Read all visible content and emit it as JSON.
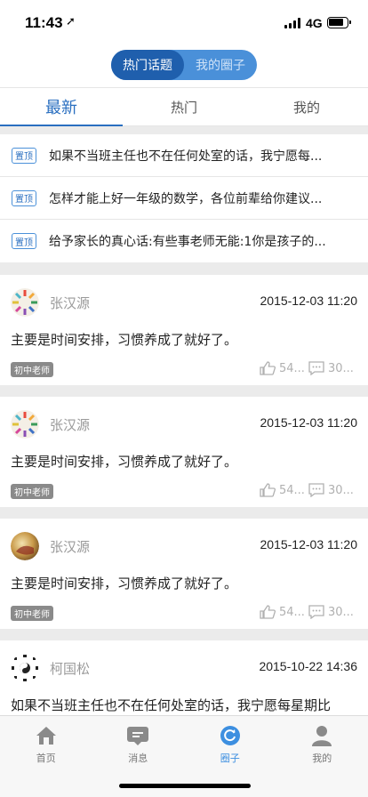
{
  "status": {
    "time": "11:43",
    "network": "4G"
  },
  "segment": {
    "items": [
      "热门话题",
      "我的圈子"
    ]
  },
  "tabs": [
    "最新",
    "热门",
    "我的"
  ],
  "pinned": [
    {
      "tag": "置顶",
      "text": "如果不当班主任也不在任何处室的话，我宁愿每..."
    },
    {
      "tag": "置顶",
      "text": "怎样才能上好一年级的数学，各位前辈给你建议..."
    },
    {
      "tag": "置顶",
      "text": "给予家长的真心话:有些事老师无能:1你是孩子的..."
    }
  ],
  "posts": [
    {
      "name": "张汉源",
      "time": "2015-12-03 11:20",
      "content": "主要是时间安排，习惯养成了就好了。",
      "role": "初中老师",
      "likes": "54...",
      "comments": "30..."
    },
    {
      "name": "张汉源",
      "time": "2015-12-03 11:20",
      "content": "主要是时间安排，习惯养成了就好了。",
      "role": "初中老师",
      "likes": "54...",
      "comments": "30..."
    },
    {
      "name": "张汉源",
      "time": "2015-12-03 11:20",
      "content": "主要是时间安排，习惯养成了就好了。",
      "role": "初中老师",
      "likes": "54...",
      "comments": "30..."
    },
    {
      "name": "柯国松",
      "time": "2015-10-22 14:36",
      "content": "如果不当班主任也不在任何处室的话，我宁愿每星期比"
    }
  ],
  "tabbar": [
    {
      "label": "首页",
      "icon": "home-icon"
    },
    {
      "label": "消息",
      "icon": "message-icon"
    },
    {
      "label": "圈子",
      "icon": "circle-refresh-icon"
    },
    {
      "label": "我的",
      "icon": "user-icon"
    }
  ],
  "colors": {
    "accent": "#2a6fc0",
    "segment_bg": "#4a90d9",
    "segment_active": "#1f5fad",
    "tab_active": "#3d8fe0"
  }
}
